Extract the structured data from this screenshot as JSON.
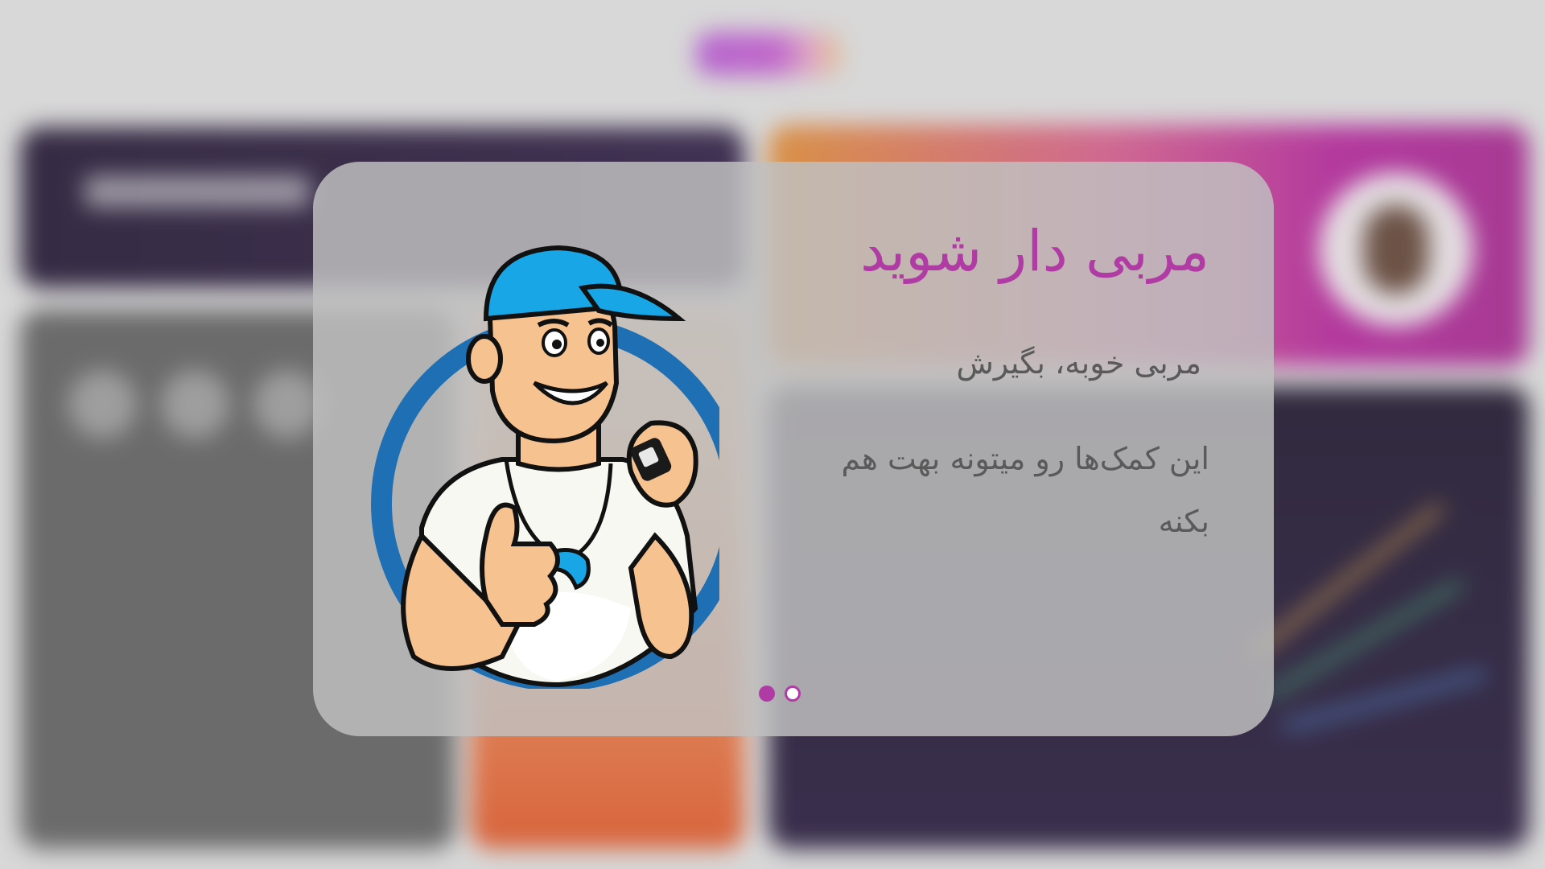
{
  "modal": {
    "title": "مربی دار شوید",
    "subtitle": "مربی خوبه، بگیرش",
    "description": "این کمک‌ها رو میتونه بهت هم بکنه",
    "illustration_icon": "coach-with-whistle-icon",
    "pagination": {
      "current": 1,
      "total": 2
    }
  },
  "colors": {
    "accent": "#b13ba4",
    "text_secondary": "#5a5a5a",
    "modal_background": "#c0c0c0",
    "coach_ring": "#1e6fb3",
    "coach_cap": "#18a6e6"
  }
}
